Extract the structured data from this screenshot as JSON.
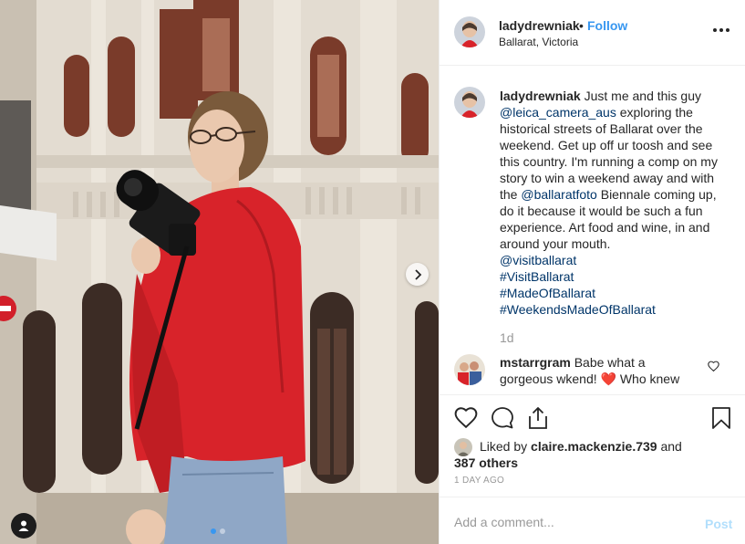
{
  "post": {
    "username": "ladydrewniak",
    "separator": "•",
    "follow_label": "Follow",
    "location": "Ballarat, Victoria",
    "more_icon": "more-options-icon"
  },
  "caption": {
    "username": "ladydrewniak",
    "text_1": "Just me and this guy",
    "mention_leica": "@leica_camera_aus",
    "text_2": "exploring the historical streets of Ballarat over the weekend. Get up off ur toosh and see this country. I'm running a comp on my story to win a weekend away and with the",
    "mention_foto": "@ballaratfoto",
    "text_3": "Biennale coming up, do it because it would be such a fun experience. Art food and wine, in and around your mouth.",
    "mention_visit": "@visitballarat",
    "hashtags": [
      "#VisitBallarat",
      "#MadeOfBallarat",
      "#WeekendsMadeOfBallarat"
    ],
    "age": "1d"
  },
  "comment": {
    "username": "mstarrgram",
    "text": "Babe what a gorgeous wkend! ❤️ Who knew"
  },
  "likes": {
    "prefix": "Liked by",
    "user": "claire.mackenzie.739",
    "and": "and",
    "others": "387 others"
  },
  "timestamp": "1 DAY AGO",
  "add_comment": {
    "placeholder": "Add a comment...",
    "post_label": "Post"
  },
  "colors": {
    "link_blue": "#3897f0",
    "mention_blue": "#003569",
    "muted": "#999999",
    "sweater_red": "#d8232a"
  },
  "icons": [
    "heart-icon",
    "comment-icon",
    "share-icon",
    "bookmark-icon",
    "chevron-right-icon",
    "user-tag-icon"
  ]
}
